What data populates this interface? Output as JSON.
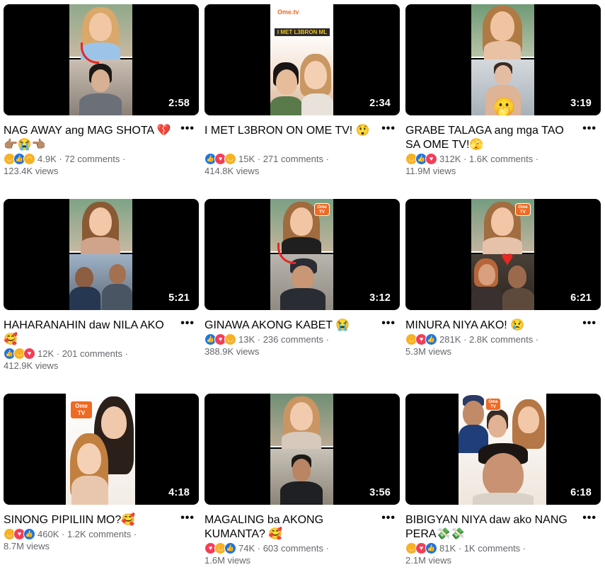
{
  "videos": [
    {
      "title": "NAG AWAY ang MAG SHOTA 💔👉🏽😭👈🏽",
      "duration": "2:58",
      "reactions": [
        "haha",
        "like",
        "sad"
      ],
      "reaction_count": "4.9K",
      "comments": "72 comments",
      "views": "123.4K views",
      "more": "•••"
    },
    {
      "title": "I MET L3BRON ON OME TV! 😲",
      "duration": "2:34",
      "reactions": [
        "like",
        "love",
        "haha"
      ],
      "reaction_count": "15K",
      "comments": "271 comments",
      "views": "414.8K views",
      "more": "•••",
      "thumb_brand": "Ome.tv",
      "thumb_caption": "I MET L3BRON ML"
    },
    {
      "title": "GRABE TALAGA ang mga TAO SA OME TV!🫣",
      "duration": "3:19",
      "reactions": [
        "haha",
        "like",
        "love"
      ],
      "reaction_count": "312K",
      "comments": "1.6K comments",
      "views": "11.9M views",
      "more": "•••"
    },
    {
      "title": "HAHARANAHIN daw NILA AKO 🥰",
      "duration": "5:21",
      "reactions": [
        "like",
        "haha",
        "love"
      ],
      "reaction_count": "12K",
      "comments": "201 comments",
      "views": "412.9K views",
      "more": "•••"
    },
    {
      "title": "GINAWA AKONG KABET 😭",
      "duration": "3:12",
      "reactions": [
        "like",
        "love",
        "haha"
      ],
      "reaction_count": "13K",
      "comments": "236 comments",
      "views": "388.9K views",
      "more": "•••"
    },
    {
      "title": "MINURA NIYA AKO! 😢",
      "duration": "6:21",
      "reactions": [
        "haha",
        "love",
        "like"
      ],
      "reaction_count": "281K",
      "comments": "2.8K comments",
      "views": "5.3M views",
      "more": "•••"
    },
    {
      "title": "SINONG PIPILIIN MO?🥰",
      "duration": "4:18",
      "reactions": [
        "haha",
        "love",
        "like"
      ],
      "reaction_count": "460K",
      "comments": "1.2K comments",
      "views": "8.7M views",
      "more": "•••"
    },
    {
      "title": "MAGALING ba AKONG KUMANTA? 🥰",
      "duration": "3:56",
      "reactions": [
        "love",
        "haha",
        "like"
      ],
      "reaction_count": "74K",
      "comments": "603 comments",
      "views": "1.6M views",
      "more": "•••"
    },
    {
      "title": "BIBIGYAN NIYA daw ako NANG PERA💸💸",
      "duration": "6:18",
      "reactions": [
        "haha",
        "love",
        "like"
      ],
      "reaction_count": "81K",
      "comments": "1K comments",
      "views": "2.1M views",
      "more": "•••"
    }
  ],
  "logo_text": "Ome TV",
  "colors": {
    "like": "#1b74e4",
    "love": "#f33e58",
    "haha": "#f7b125",
    "meta_text": "#65676b",
    "duration_text": "#ffffff",
    "brand_orange": "#ef6a23"
  }
}
